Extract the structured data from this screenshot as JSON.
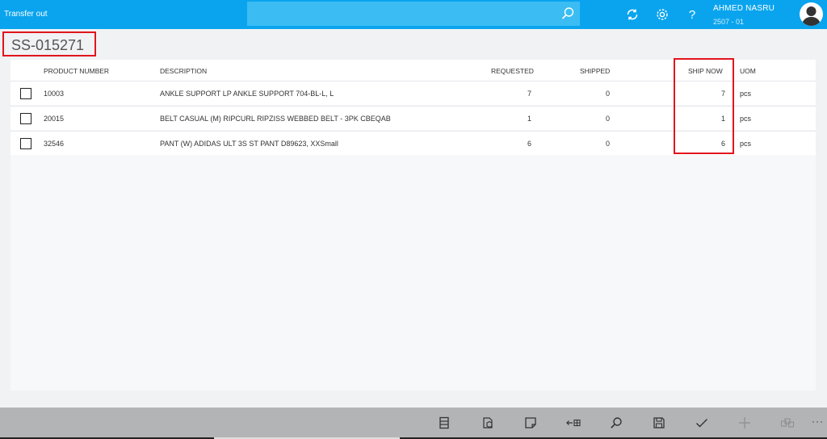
{
  "header": {
    "app_title": "Transfer out",
    "search_placeholder": "",
    "user_name": "AHMED NASRU",
    "user_sub": "2507 - 01",
    "icons": [
      "refresh-icon",
      "gear-icon",
      "help-icon",
      "avatar-icon"
    ]
  },
  "document": {
    "id": "SS-015271"
  },
  "table": {
    "columns": {
      "product_number": "PRODUCT NUMBER",
      "description": "DESCRIPTION",
      "requested": "REQUESTED",
      "shipped": "SHIPPED",
      "ship_now": "SHIP NOW",
      "uom": "UOM"
    },
    "rows": [
      {
        "product_number": "10003",
        "description": "ANKLE SUPPORT LP ANKLE SUPPORT 704-BL-L, L",
        "requested": "7",
        "shipped": "0",
        "ship_now": "7",
        "uom": "pcs"
      },
      {
        "product_number": "20015",
        "description": "BELT CASUAL (M) RIPCURL RIPZISS WEBBED BELT - 3PK CBEQAB",
        "requested": "1",
        "shipped": "0",
        "ship_now": "1",
        "uom": "pcs"
      },
      {
        "product_number": "32546",
        "description": "PANT (W) ADIDAS ULT 3S ST PANT D89623, XXSmall",
        "requested": "6",
        "shipped": "0",
        "ship_now": "6",
        "uom": "pcs"
      }
    ]
  },
  "footer": {
    "icons": [
      "document-list-icon",
      "box-icon",
      "note-icon",
      "move-left-icon",
      "search-icon",
      "save-icon",
      "check-icon",
      "add-icon",
      "boxes-icon",
      "more-icon"
    ],
    "more_label": "···"
  },
  "colors": {
    "accent": "#0aa4ee",
    "highlight": "#e2141c",
    "footer": "#b3b4b6"
  }
}
